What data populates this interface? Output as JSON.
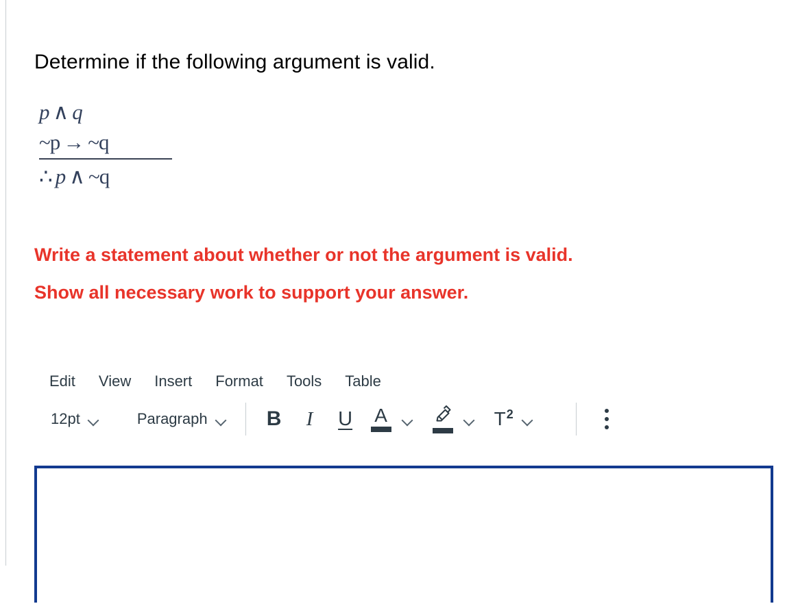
{
  "question": {
    "heading": "Determine if the following argument is valid.",
    "argument": {
      "premise_1": {
        "left": "p",
        "operator": "∧",
        "right": "q"
      },
      "premise_2": {
        "left": "~p",
        "operator": "→",
        "right": "~q"
      },
      "conclusion": {
        "therefore": "∴",
        "left": "p",
        "operator": "∧",
        "right": "~q"
      }
    },
    "instruction_line_1": "Write a statement about whether or not the argument is valid.",
    "instruction_line_2": "Show all necessary work to support your answer.",
    "instruction_color": "#e8342a"
  },
  "editor": {
    "menubar": [
      {
        "label": "Edit"
      },
      {
        "label": "View"
      },
      {
        "label": "Insert"
      },
      {
        "label": "Format"
      },
      {
        "label": "Tools"
      },
      {
        "label": "Table"
      }
    ],
    "toolbar": {
      "font_size": "12pt",
      "block_format": "Paragraph",
      "bold_label": "B",
      "italic_label": "I",
      "underline_label": "U",
      "text_color_label": "A",
      "text_color_swatch": "#2d3b45",
      "highlight_swatch": "#2d3b45",
      "superscript_label": "T",
      "superscript_exponent": "2"
    },
    "answer": {
      "value": "",
      "placeholder": "",
      "border_color": "#123a8f"
    }
  }
}
